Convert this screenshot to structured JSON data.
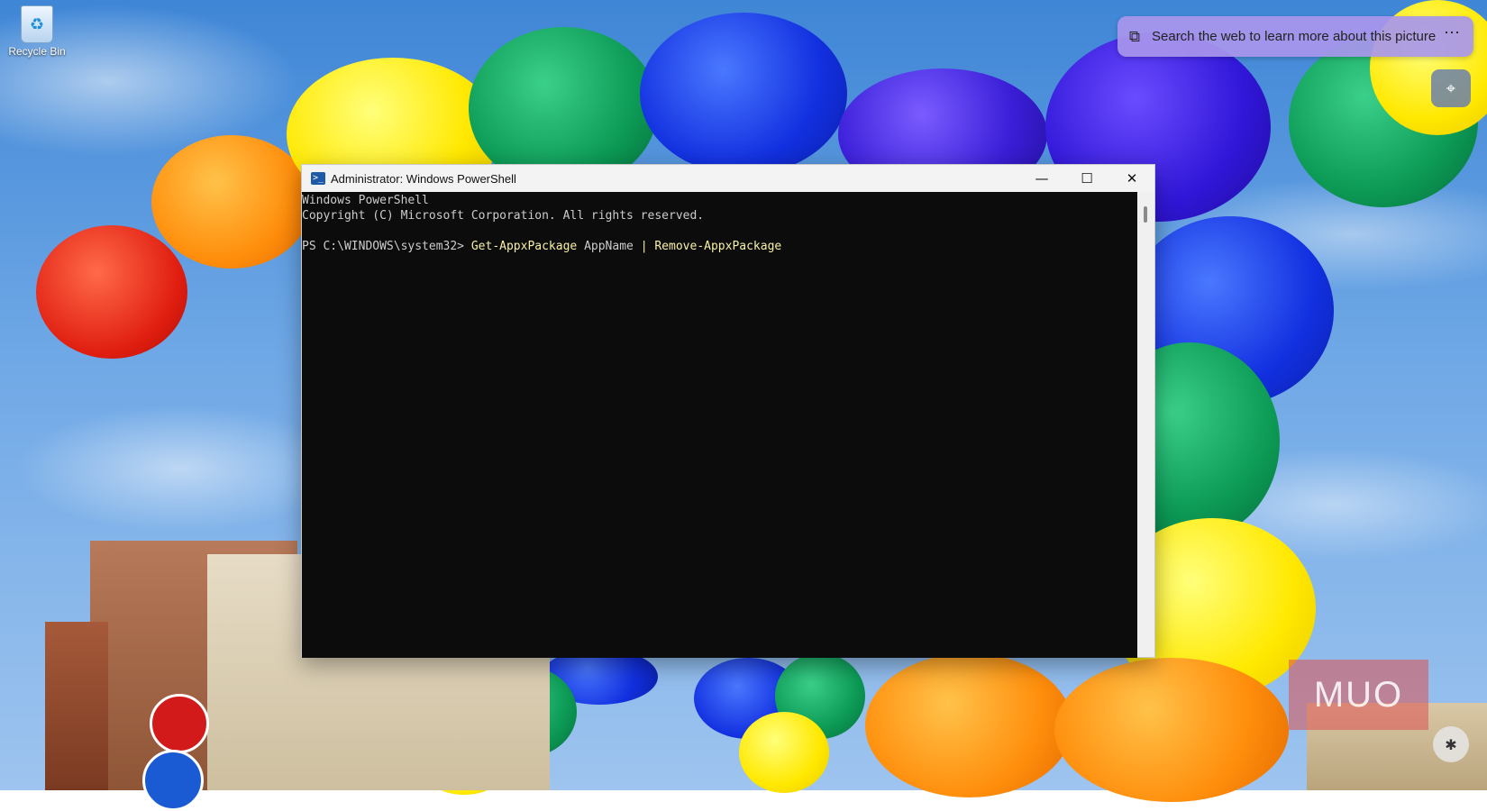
{
  "desktop": {
    "icons": [
      {
        "label": "Recycle Bin",
        "icon": "recycle-bin-icon"
      }
    ]
  },
  "visual_search": {
    "text": "Search the web to learn more about this picture",
    "icon": "image-search-icon",
    "more_glyph": "⋯",
    "lens_icon": "screenshot-lens-icon"
  },
  "window": {
    "title": "Administrator: Windows PowerShell",
    "app_icon": "powershell-icon",
    "minimize_glyph": "—",
    "maximize_glyph": "☐",
    "close_glyph": "✕"
  },
  "console": {
    "header_line": "Windows PowerShell",
    "copyright_line": "Copyright (C) Microsoft Corporation. All rights reserved.",
    "prompt": "PS C:\\WINDOWS\\system32> ",
    "cmd1": "Get-AppxPackage",
    "arg1": " AppName ",
    "pipe": "| ",
    "cmd2": "Remove-AppxPackage"
  },
  "watermark": {
    "text": "MUO"
  },
  "colors": {
    "console_bg": "#0c0c0c",
    "console_fg": "#cccccc",
    "command_fg": "#f9f1a5",
    "search_pill_bg": "#a896eb"
  }
}
